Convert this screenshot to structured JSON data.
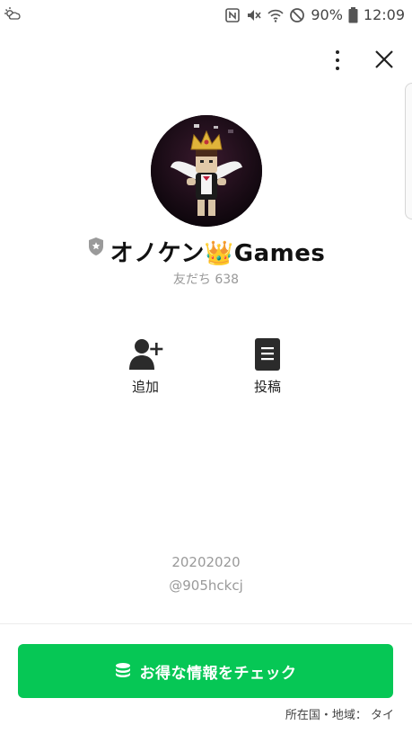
{
  "status_bar": {
    "battery_percent": "90%",
    "time": "12:09",
    "icons": [
      "weather-icon",
      "nfc-icon",
      "mute-icon",
      "wifi-icon",
      "do-not-disturb-icon",
      "battery-icon"
    ]
  },
  "header": {
    "more_icon": "more-vertical-icon",
    "close_icon": "close-icon"
  },
  "profile": {
    "badge_icon": "shield-star-icon",
    "name": "オノケン👑Games",
    "friends": "友だち 638"
  },
  "actions": [
    {
      "id": "add",
      "label": "追加",
      "icon": "add-friend-icon"
    },
    {
      "id": "post",
      "label": "投稿",
      "icon": "post-icon"
    }
  ],
  "info": {
    "code": "20202020",
    "handle": "@905hckcj"
  },
  "cta": {
    "label": "お得な情報をチェック",
    "icon": "coins-icon",
    "color": "#06c755"
  },
  "region": "所在国・地域： タイ"
}
